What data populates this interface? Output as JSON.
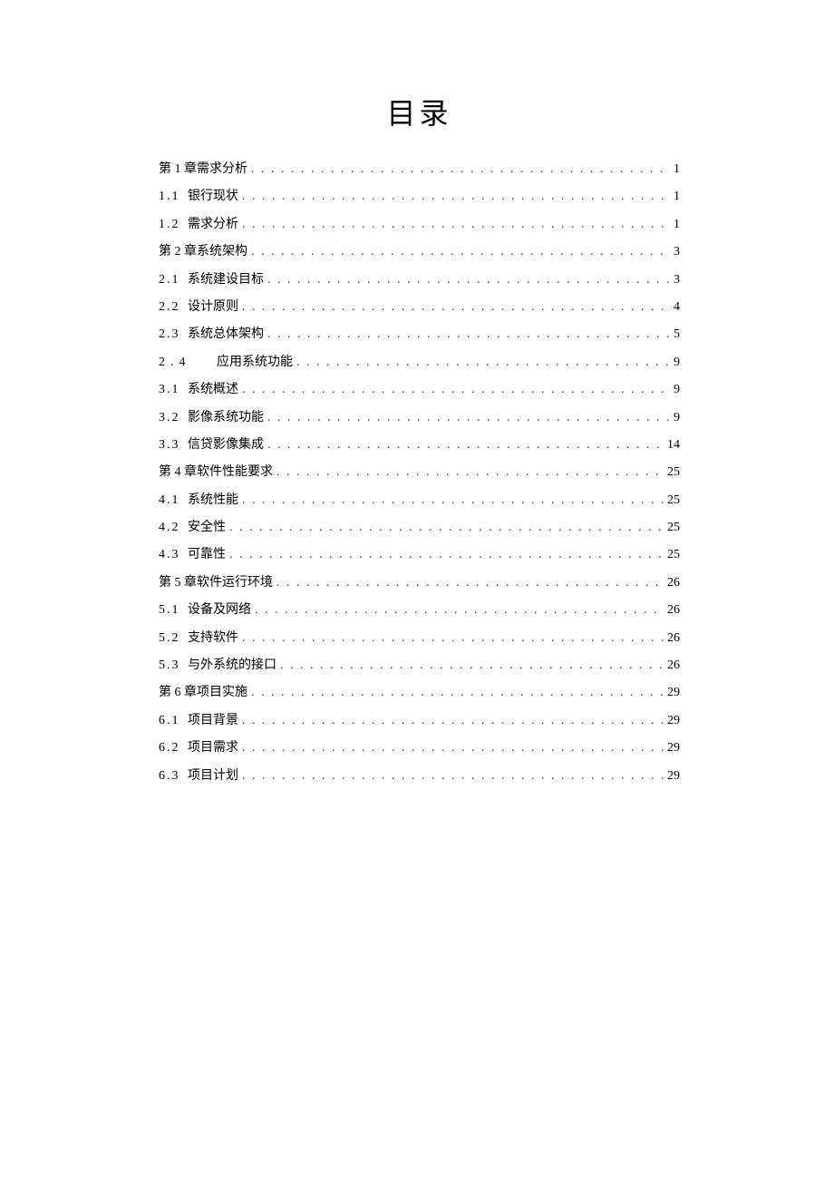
{
  "title": "目录",
  "dots": ". . . . . . . . . . . . . . . . . . . . . . . . . . . . . . . . . . . . . . . . . . . . . . . . . . . . . . . . . . . . . . . . . . . . . . . . . . . . . . . . . . . . . . . . . . . . . . . . . . . . . . . . . . . . . . . . . . . . . . . . . . . . . . . . . . . . . . . . . . . . . . . . . . . .",
  "entries": [
    {
      "type": "chapter",
      "label": "第 1 章需求分析",
      "page": "1"
    },
    {
      "type": "sub",
      "num": "1.1",
      "label": "银行现状",
      "page": "1"
    },
    {
      "type": "sub",
      "num": "1.2",
      "label": "需求分析",
      "page": "1"
    },
    {
      "type": "chapter",
      "label": "第 2 章系统架构",
      "page": "3"
    },
    {
      "type": "sub",
      "num": "2.1",
      "label": "系统建设目标",
      "page": "3"
    },
    {
      "type": "sub",
      "num": "2.2",
      "label": "设计原则",
      "page": "4"
    },
    {
      "type": "sub",
      "num": "2.3",
      "label": "系统总体架构",
      "page": "5"
    },
    {
      "type": "sub-wide",
      "num": "2.4",
      "label": "应用系统功能",
      "page": "9"
    },
    {
      "type": "sub",
      "num": "3.1",
      "label": "系统概述",
      "page": "9"
    },
    {
      "type": "sub",
      "num": "3.2",
      "label": "影像系统功能",
      "page": "9"
    },
    {
      "type": "sub",
      "num": "3.3",
      "label": "信贷影像集成",
      "page": "14"
    },
    {
      "type": "chapter",
      "label": "第 4 章软件性能要求",
      "page": "25"
    },
    {
      "type": "sub",
      "num": "4.1",
      "label": "系统性能",
      "page": "25"
    },
    {
      "type": "sub",
      "num": "4.2",
      "label": "安全性",
      "page": "25"
    },
    {
      "type": "sub",
      "num": "4.3",
      "label": "可靠性",
      "page": "25"
    },
    {
      "type": "chapter",
      "label": "第 5 章软件运行环境",
      "page": "26"
    },
    {
      "type": "sub",
      "num": "5.1",
      "label": "设备及网络",
      "page": "26"
    },
    {
      "type": "sub",
      "num": "5.2",
      "label": "支持软件",
      "page": "26"
    },
    {
      "type": "sub",
      "num": "5.3",
      "label": "与外系统的接口",
      "page": "26"
    },
    {
      "type": "chapter",
      "label": "第 6 章项目实施",
      "page": "29"
    },
    {
      "type": "sub",
      "num": "6.1",
      "label": "项目背景",
      "page": "29"
    },
    {
      "type": "sub",
      "num": "6.2",
      "label": "项目需求",
      "page": "29"
    },
    {
      "type": "sub",
      "num": "6.3",
      "label": "项目计划",
      "page": "29"
    }
  ]
}
